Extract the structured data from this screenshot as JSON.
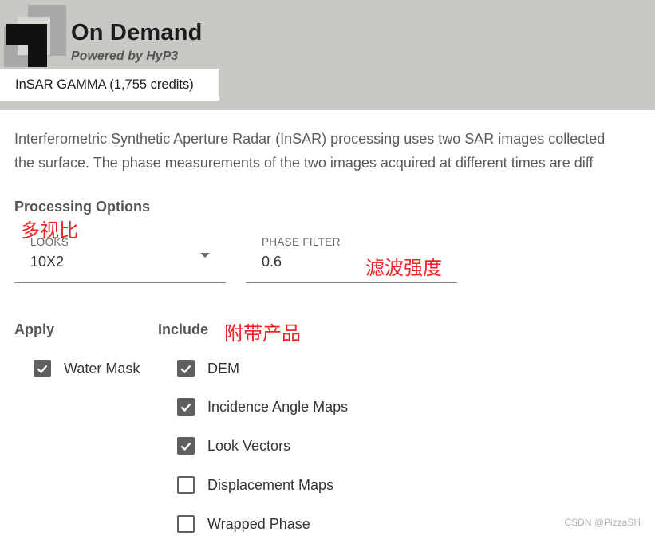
{
  "header": {
    "title": "On Demand",
    "subtitle": "Powered by HyP3",
    "job_tab": "InSAR GAMMA (1,755 credits)",
    "logo_icon": "stacked-squares-logo-icon"
  },
  "description": {
    "line1": "Interferometric Synthetic Aperture Radar (InSAR) processing uses two SAR images collected",
    "line2": "the surface. The phase measurements of the two images acquired at different times are diff"
  },
  "processing": {
    "title": "Processing Options",
    "annotation": "多视比",
    "looks": {
      "label": "LOOKS",
      "value": "10X2"
    },
    "phase_filter": {
      "label": "PHASE FILTER",
      "value": "0.6",
      "annotation": "滤波强度"
    }
  },
  "apply": {
    "heading": "Apply",
    "items": [
      {
        "label": "Water Mask",
        "checked": true
      }
    ]
  },
  "include": {
    "heading": "Include",
    "annotation": "附带产品",
    "items": [
      {
        "label": "DEM",
        "checked": true
      },
      {
        "label": "Incidence Angle Maps",
        "checked": true
      },
      {
        "label": "Look Vectors",
        "checked": true
      },
      {
        "label": "Displacement Maps",
        "checked": false
      },
      {
        "label": "Wrapped Phase",
        "checked": false
      }
    ]
  },
  "watermark": "CSDN @PizzaSH",
  "colors": {
    "header_bg": "#c8c8c4",
    "checkbox": "#5f5f5f",
    "annotation": "#ee2222"
  }
}
